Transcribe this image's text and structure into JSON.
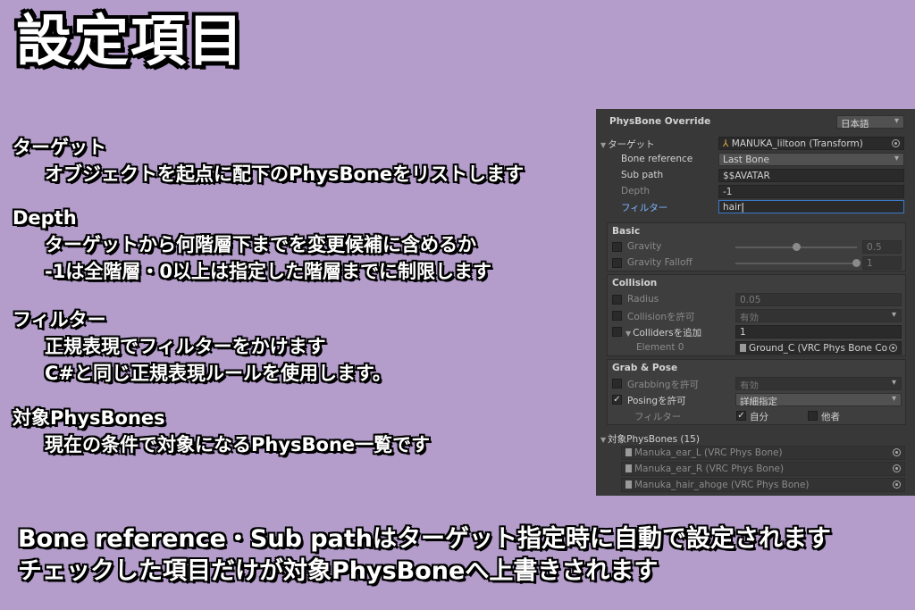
{
  "title": "設定項目",
  "explanations": [
    {
      "heading": "ターゲット",
      "lines": [
        "オブジェクトを起点に配下のPhysBoneをリストします"
      ]
    },
    {
      "heading": "Depth",
      "lines": [
        "ターゲットから何階層下までを変更候補に含めるか",
        "-1は全階層・0以上は指定した階層までに制限します"
      ]
    },
    {
      "heading": "フィルター",
      "lines": [
        "正規表現でフィルターをかけます",
        "C#と同じ正規表現ルールを使用します。"
      ]
    },
    {
      "heading": "対象PhysBones",
      "lines": [
        "現在の条件で対象になるPhysBone一覧です"
      ]
    }
  ],
  "bottom_notes": [
    "Bone reference・Sub pathはターゲット指定時に自動で設定されます",
    "チェックした項目だけが対象PhysBoneへ上書きされます"
  ],
  "panel": {
    "title": "PhysBone Override",
    "language": "日本語",
    "target_label": "ターゲット",
    "target_value": "MANUKA_liltoon (Transform)",
    "bone_reference_label": "Bone reference",
    "bone_reference_value": "Last Bone",
    "sub_path_label": "Sub path",
    "sub_path_value": "$$AVATAR",
    "depth_label": "Depth",
    "depth_value": "-1",
    "filter_label": "フィルター",
    "filter_value": "hair",
    "basic": {
      "header": "Basic",
      "gravity_label": "Gravity",
      "gravity_value": "0.5",
      "gravity_level": 0.5,
      "gravity_falloff_label": "Gravity Falloff",
      "gravity_falloff_value": "1",
      "gravity_falloff_level": 1.0
    },
    "collision": {
      "header": "Collision",
      "radius_label": "Radius",
      "radius_value": "0.05",
      "allow_collision_label": "Collisionを許可",
      "allow_collision_value": "有効",
      "add_colliders_label": "Collidersを追加",
      "add_colliders_count": "1",
      "element_label": "Element 0",
      "element_value": "Ground_C (VRC Phys Bone Co"
    },
    "grab_pose": {
      "header": "Grab & Pose",
      "grabbing_label": "Grabbingを許可",
      "grabbing_value": "有効",
      "posing_label": "Posingを許可",
      "posing_value": "詳細指定",
      "filter_label": "フィルター",
      "self_label": "自分",
      "others_label": "他者"
    },
    "targets_header": "対象PhysBones (15)",
    "targets": [
      "Manuka_ear_L (VRC Phys Bone)",
      "Manuka_ear_R (VRC Phys Bone)",
      "Manuka_hair_ahoge (VRC Phys Bone)"
    ]
  }
}
